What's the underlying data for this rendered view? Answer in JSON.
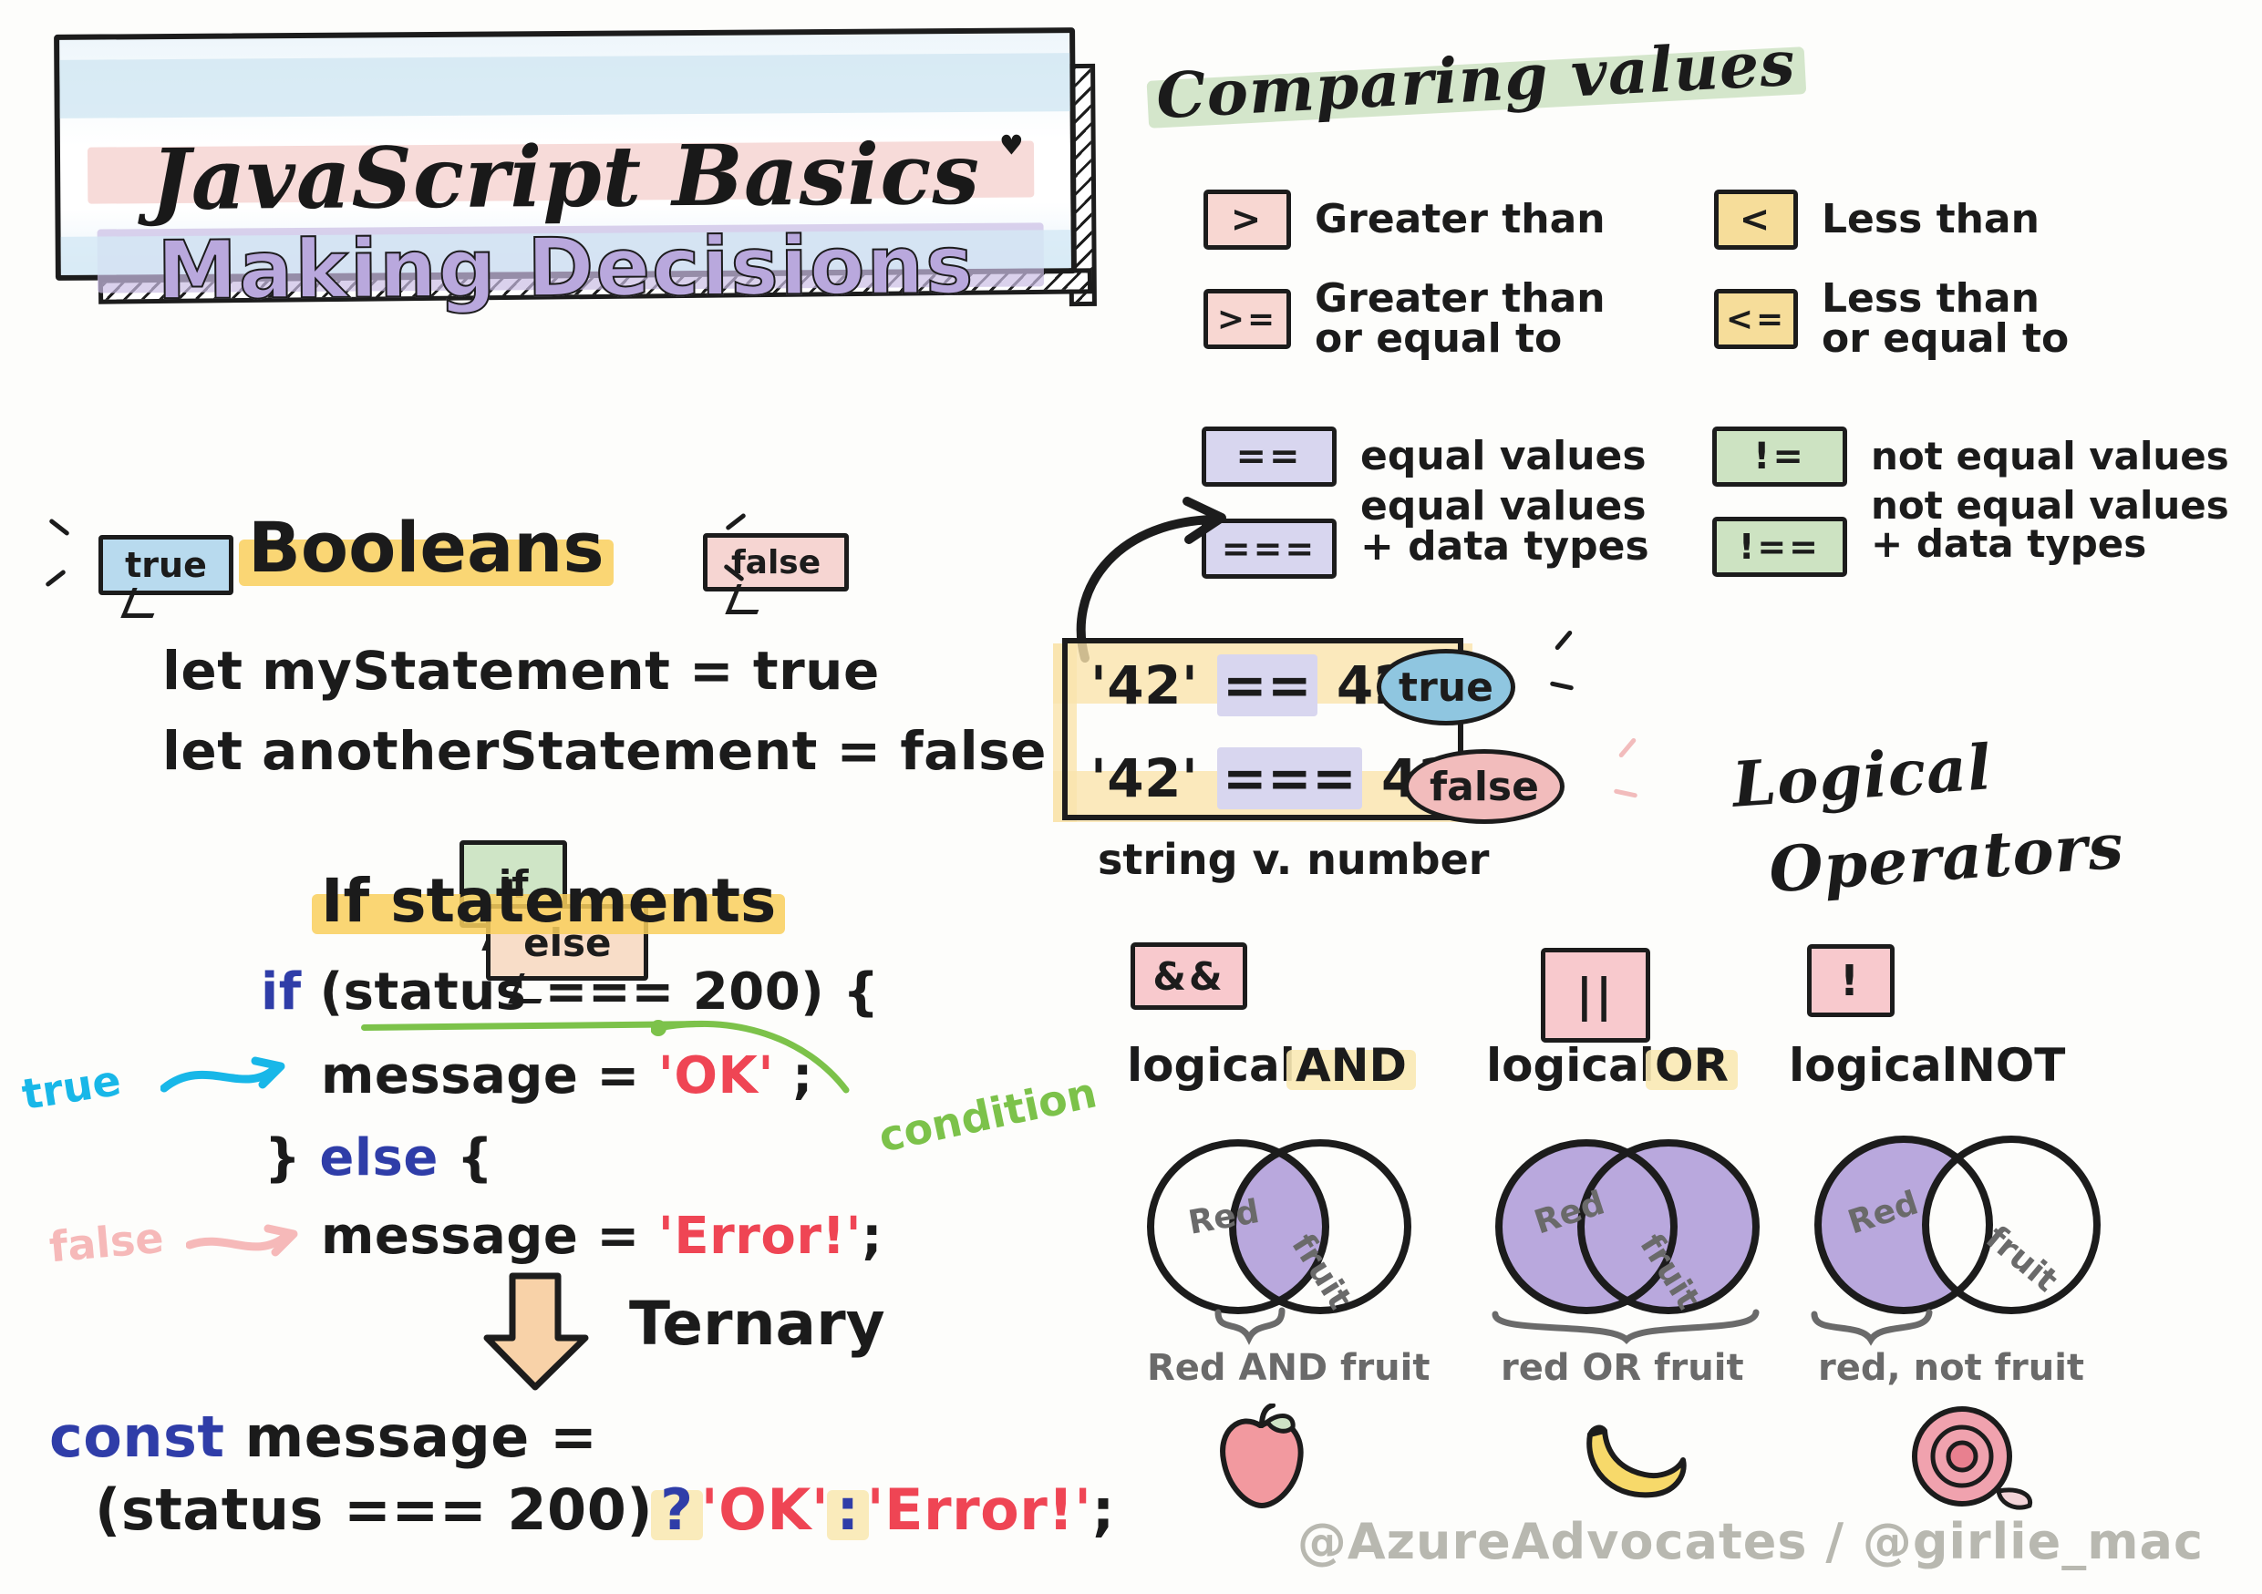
{
  "title": {
    "line1": "JavaScript Basics",
    "line2": "Making Decisions",
    "heart_icon": "heart-icon"
  },
  "booleans": {
    "heading": "Booleans",
    "bubble_true": "true",
    "bubble_false": "false",
    "code_lines": [
      "let myStatement = true",
      "let anotherStatement = false"
    ]
  },
  "if_statements": {
    "heading": "If statements",
    "bubble_if": "if",
    "bubble_else": "else",
    "code": {
      "line1_kw": "if",
      "line1_rest": "(status === 200) {",
      "line2_pre": "message = ",
      "line2_str": "'OK'",
      "line2_post": " ;",
      "line3_brace1": "}",
      "line3_kw": "else",
      "line3_brace2": "{",
      "line4_pre": "message = ",
      "line4_str": "'Error!'",
      "line4_post": ";"
    },
    "annot_true": "true",
    "annot_false": "false",
    "annot_condition": "condition"
  },
  "ternary": {
    "heading": "Ternary",
    "arrow_icon": "down-arrow-icon",
    "line1_kw": "const",
    "line1_rest": "message =",
    "line2_cond": "(status === 200)",
    "line2_q": "?",
    "line2_ok": "'OK'",
    "line2_colon": ":",
    "line2_err": "'Error!'",
    "line2_semi": ";"
  },
  "comparing": {
    "heading": "Comparing values",
    "left_column": [
      {
        "symbol": ">",
        "label_line1": "Greater than",
        "label_line2": "",
        "chip_color": "#f8d7d2"
      },
      {
        "symbol": ">=",
        "label_line1": "Greater than",
        "label_line2": "or equal to",
        "chip_color": "#f8d7d2"
      }
    ],
    "right_column": [
      {
        "symbol": "<",
        "label_line1": "Less than",
        "label_line2": "",
        "chip_color": "#f6dd9a"
      },
      {
        "symbol": "<=",
        "label_line1": "Less than",
        "label_line2": "or equal to",
        "chip_color": "#f6dd9a"
      }
    ],
    "equality_left": [
      {
        "symbol": "==",
        "label_line1": "equal values",
        "label_line2": "",
        "chip_color": "#d8d6ef"
      },
      {
        "symbol": "===",
        "label_line1": "equal values",
        "label_line2": "+ data types",
        "chip_color": "#d8d6ef"
      }
    ],
    "equality_right": [
      {
        "symbol": "!=",
        "label_line1": "not equal values",
        "label_line2": "",
        "chip_color": "#cde3c2"
      },
      {
        "symbol": "!==",
        "label_line1": "not equal values",
        "label_line2": "+ data types",
        "chip_color": "#cde3c2"
      }
    ],
    "example": {
      "line1_left": "'42'",
      "line1_op": "==",
      "line1_right": "42",
      "line1_result": "true",
      "line2_left": "'42'",
      "line2_op": "===",
      "line2_right": "42",
      "line2_result": "false",
      "caption": "string v. number"
    }
  },
  "logical": {
    "heading_line1": "Logical",
    "heading_line2": "Operators",
    "items": [
      {
        "symbol": "&&",
        "label_plain": "logical",
        "label_hl": "AND",
        "venn": "and",
        "caption": "Red AND fruit",
        "fruit_icon": "apple-icon"
      },
      {
        "symbol": "||",
        "label_plain": "logical",
        "label_hl": "OR",
        "venn": "or",
        "caption": "red OR fruit",
        "fruit_icon": "banana-icon"
      },
      {
        "symbol": "!",
        "label_plain": "logical",
        "label_hl": "NOT",
        "venn": "not",
        "caption": "red, not fruit",
        "fruit_icon": "rose-icon"
      }
    ],
    "venn_label_left": "Red",
    "venn_label_right": "fruit"
  },
  "footer": {
    "credits": "@AzureAdvocates / @girlie_mac"
  },
  "colors": {
    "ink": "#1c1c1c",
    "purple": "#b9a8dd",
    "pink": "#f6d5d2",
    "yellow": "#f9cf5c",
    "green": "#cfe3c5",
    "blue": "#b8daee",
    "red_string": "#ef4554",
    "keyword_blue": "#2f3da8",
    "condition_green": "#7cc24a",
    "true_cyan": "#18b7e8",
    "false_pink": "#f6b9b9",
    "venn_fill": "#b9a8dd",
    "muted_gray": "#6a6a6a"
  }
}
